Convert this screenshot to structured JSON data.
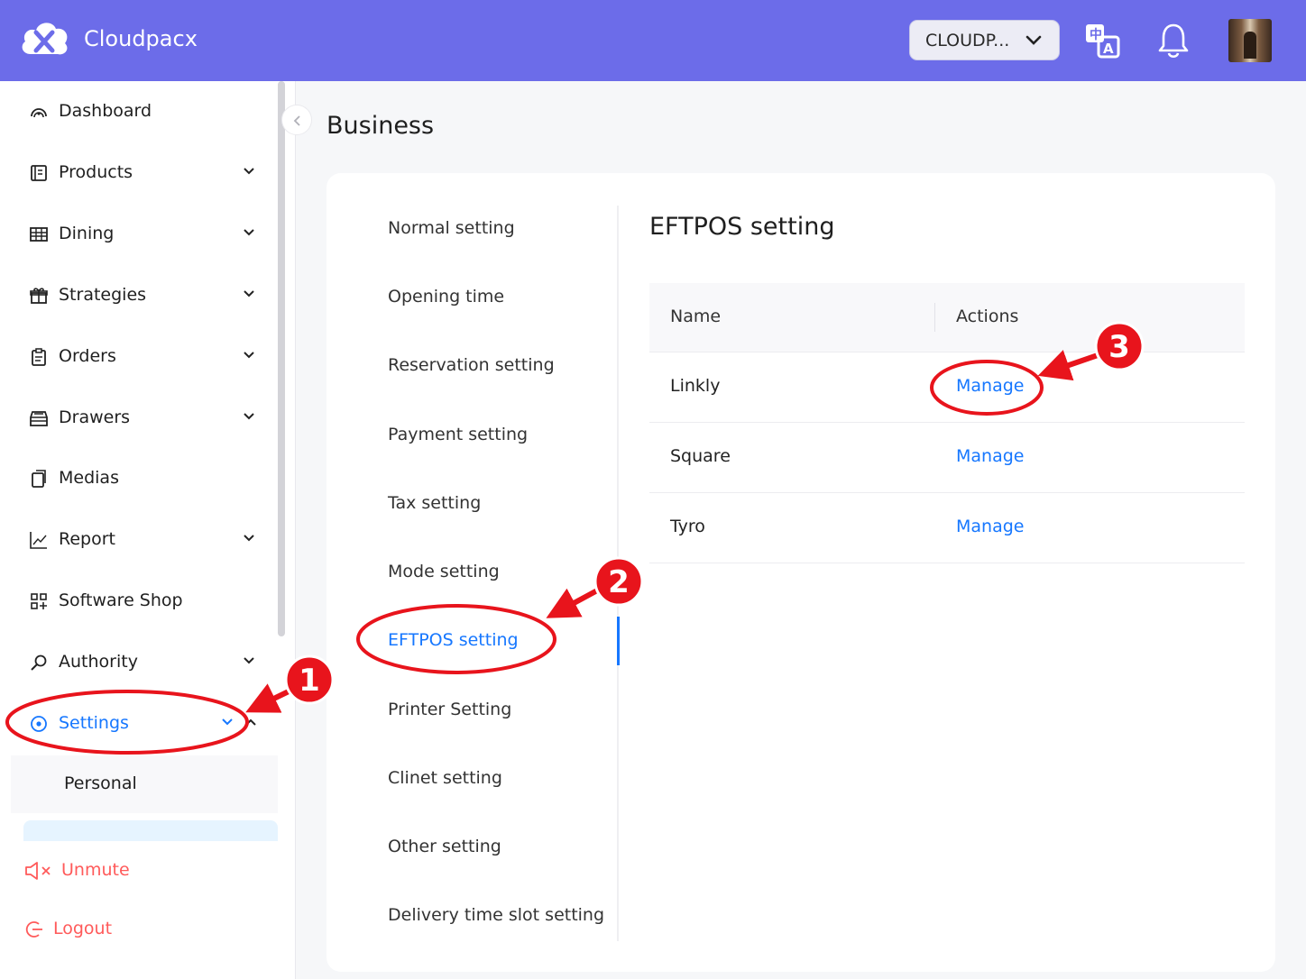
{
  "header": {
    "app_name": "Cloudpacx",
    "store_selector": "CLOUDP..."
  },
  "sidebar": {
    "items": [
      {
        "label": "Dashboard",
        "icon": "dashboard-icon"
      },
      {
        "label": "Products",
        "icon": "products-icon",
        "expandable": true
      },
      {
        "label": "Dining",
        "icon": "dining-icon",
        "expandable": true
      },
      {
        "label": "Strategies",
        "icon": "gift-icon",
        "expandable": true
      },
      {
        "label": "Orders",
        "icon": "clipboard-icon",
        "expandable": true
      },
      {
        "label": "Drawers",
        "icon": "drawer-icon",
        "expandable": true
      },
      {
        "label": "Medias",
        "icon": "media-icon"
      },
      {
        "label": "Report",
        "icon": "chart-icon",
        "expandable": true
      },
      {
        "label": "Software Shop",
        "icon": "apps-icon"
      },
      {
        "label": "Authority",
        "icon": "key-icon",
        "expandable": true
      },
      {
        "label": "Settings",
        "icon": "settings-icon",
        "expandable": true,
        "active": true
      }
    ],
    "sub_items": [
      {
        "label": "Personal"
      }
    ],
    "bottom": {
      "unmute": "Unmute",
      "logout": "Logout"
    }
  },
  "main": {
    "page_title": "Business",
    "settings_menu": [
      "Normal setting",
      "Opening time",
      "Reservation setting",
      "Payment setting",
      "Tax setting",
      "Mode setting",
      "EFTPOS setting",
      "Printer Setting",
      "Clinet setting",
      "Other setting",
      "Delivery time slot setting"
    ],
    "active_menu": "EFTPOS setting",
    "panel_title": "EFTPOS setting",
    "table": {
      "columns": [
        "Name",
        "Actions"
      ],
      "rows": [
        {
          "name": "Linkly",
          "action": "Manage"
        },
        {
          "name": "Square",
          "action": "Manage"
        },
        {
          "name": "Tyro",
          "action": "Manage"
        }
      ]
    }
  },
  "annotations": {
    "steps": [
      "1",
      "2",
      "3"
    ],
    "color": "#e8141c"
  },
  "colors": {
    "header_bg": "#6c6ce9",
    "accent": "#1677ff",
    "danger": "#ff5a5a"
  }
}
